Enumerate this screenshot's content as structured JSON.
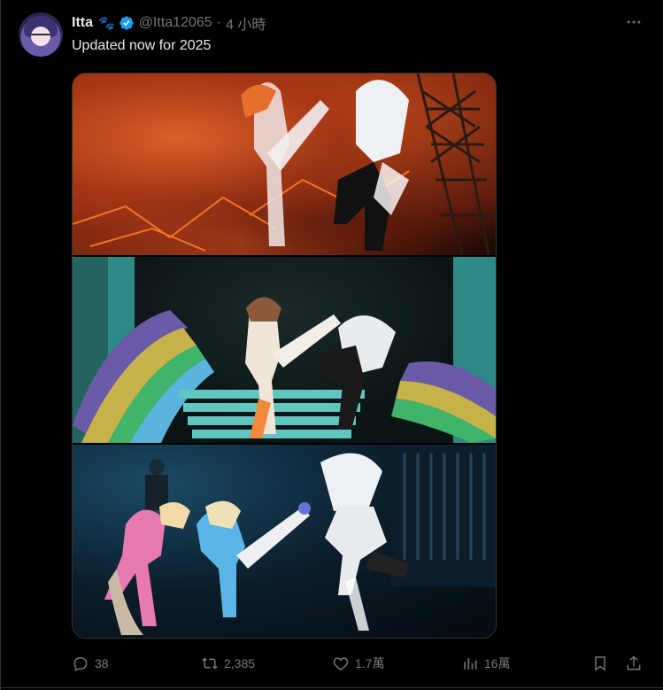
{
  "tweet": {
    "display_name": "Itta",
    "name_emoji": "🐾",
    "verified": true,
    "handle": "@Itta12065",
    "separator": "·",
    "time": "4 小時",
    "text": "Updated now for 2025"
  },
  "media": {
    "panels": [
      {
        "theme": "red-stage"
      },
      {
        "theme": "teal-stage"
      },
      {
        "theme": "blue-concert"
      }
    ]
  },
  "actions": {
    "reply_count": "38",
    "repost_count": "2,385",
    "like_count": "1.7萬",
    "view_count": "16萬"
  },
  "colors": {
    "background": "#000000",
    "text_primary": "#e7e9ea",
    "text_secondary": "#71767b",
    "verified": "#1d9bf0",
    "border": "#2f3336"
  },
  "icons": {
    "more": "more-icon",
    "reply": "reply-icon",
    "repost": "repost-icon",
    "like": "like-icon",
    "views": "views-icon",
    "bookmark": "bookmark-icon",
    "share": "share-icon",
    "verified": "verified-badge-icon"
  }
}
